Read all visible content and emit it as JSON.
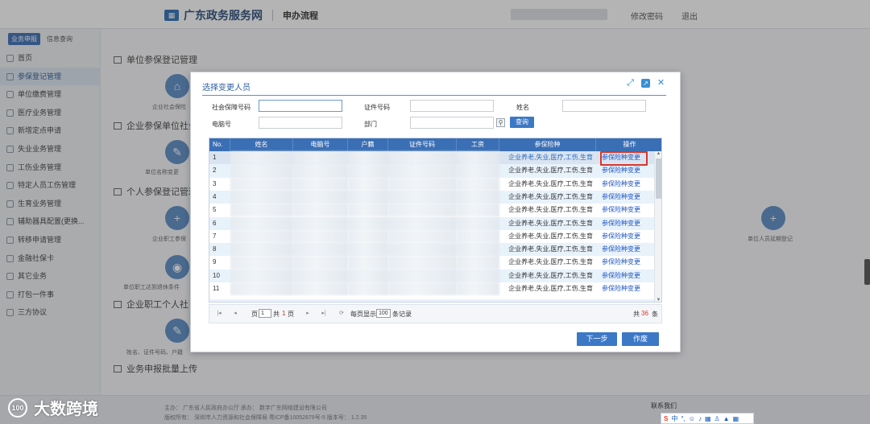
{
  "header": {
    "brand": "广东政务服务网",
    "sub": "申办流程",
    "change_password": "修改密码",
    "logout": "退出"
  },
  "sidebar": {
    "tabs": [
      "业务申报",
      "信息查询"
    ],
    "items": [
      "首页",
      "参保登记管理",
      "单位缴费管理",
      "医疗业务管理",
      "新增定点申请",
      "失业业务管理",
      "工伤业务管理",
      "特定人员工伤管理",
      "生育业务管理",
      "辅助器具配置(更换...",
      "转移申请管理",
      "金融社保卡",
      "其它业务",
      "打包一件事",
      "三方协议"
    ]
  },
  "main": {
    "sections": [
      "单位参保登记管理",
      "企业参保单位社会",
      "个人参保登记管理",
      "企业职工个人社",
      "业务申报批量上传"
    ],
    "icon_labels": [
      "企业社会保险",
      "单位名称变更",
      "企业职工参保",
      "单位职工达到退休条件",
      "单位人员延期登记",
      "姓名、证件号码、户籍"
    ]
  },
  "modal": {
    "title": "选择变更人员",
    "form": {
      "ssn_label": "社会保障号码",
      "id_label": "证件号码",
      "name_label": "姓名",
      "phone_label": "电脑号",
      "dept_label": "部门",
      "query": "查询"
    },
    "columns": [
      "No.",
      "姓名",
      "电脑号",
      "户籍",
      "证件号码",
      "工资",
      "参保险种",
      "操作"
    ],
    "rows": [
      {
        "no": "1",
        "ins": "企业养老,失业,医疗,工伤,生育",
        "op": "参保险种变更"
      },
      {
        "no": "2",
        "ins": "企业养老,失业,医疗,工伤,生育",
        "op": "参保险种变更"
      },
      {
        "no": "3",
        "ins": "企业养老,失业,医疗,工伤,生育",
        "op": "参保险种变更"
      },
      {
        "no": "4",
        "ins": "企业养老,失业,医疗,工伤,生育",
        "op": "参保险种变更"
      },
      {
        "no": "5",
        "ins": "企业养老,失业,医疗,工伤,生育",
        "op": "参保险种变更"
      },
      {
        "no": "6",
        "ins": "企业养老,失业,医疗,工伤,生育",
        "op": "参保险种变更"
      },
      {
        "no": "7",
        "ins": "企业养老,失业,医疗,工伤,生育",
        "op": "参保险种变更"
      },
      {
        "no": "8",
        "ins": "企业养老,失业,医疗,工伤,生育",
        "op": "参保险种变更"
      },
      {
        "no": "9",
        "ins": "企业养老,失业,医疗,工伤,生育",
        "op": "参保险种变更"
      },
      {
        "no": "10",
        "ins": "企业养老,失业,医疗,工伤,生育",
        "op": "参保险种变更"
      },
      {
        "no": "11",
        "ins": "企业养老,失业,医疗,工伤,生育",
        "op": "参保险种变更"
      }
    ],
    "pager": {
      "page_prefix": "页",
      "page": "1",
      "total_prefix": "共",
      "total_pages": "1",
      "page_suffix": "页",
      "per_page_prefix": "每页显示",
      "per_page": "100",
      "per_page_suffix": "条记录",
      "total_records_prefix": "共",
      "total_records": "36",
      "total_records_suffix": "条"
    },
    "next": "下一步",
    "cancel": "作废"
  },
  "footer": {
    "organizer": "主办：  广东省人民政府办公厅   承办：  数字广东网络建设有限公司",
    "copyright": "版权所有：  深圳市人力资源和社会保障局  粤ICP备10052879号-5   版本号：  1.2.35",
    "contact": "联系我们"
  },
  "watermark": "大数跨境",
  "ime": {
    "brand": "S",
    "text": "中"
  }
}
